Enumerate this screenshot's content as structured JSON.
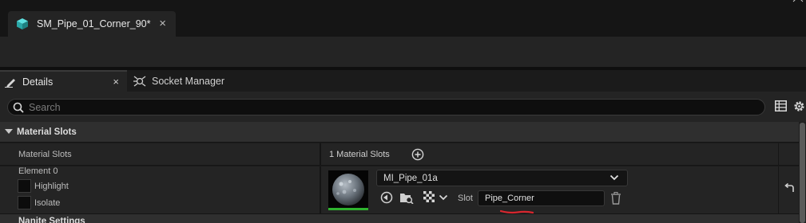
{
  "window": {
    "tab_title": "SM_Pipe_01_Corner_90*",
    "tab_close": "×",
    "icons": [
      "static-mesh-icon",
      "minimize-icon",
      "restore-icon",
      "close-icon"
    ]
  },
  "panel_tabs": {
    "details": {
      "label": "Details",
      "close": "×",
      "icon": "pencil-icon"
    },
    "socket_manager": {
      "label": "Socket Manager",
      "icon": "socket-icon"
    }
  },
  "search": {
    "placeholder": "Search",
    "value": ""
  },
  "sections": {
    "material_slots": {
      "title": "Material Slots",
      "row_label": "Material Slots",
      "count_text": "1 Material Slots",
      "element": {
        "label": "Element 0",
        "highlight_label": "Highlight",
        "isolate_label": "Isolate",
        "highlight_checked": false,
        "isolate_checked": false,
        "material": "MI_Pipe_01a",
        "slot_label": "Slot",
        "slot_name": "Pipe_Corner"
      }
    },
    "nanite": {
      "title": "Nanite Settings"
    }
  },
  "colors": {
    "accent_green": "#2fb32f",
    "mesh_icon_teal": "#31c4c4",
    "annotation_red": "#d8262e"
  }
}
